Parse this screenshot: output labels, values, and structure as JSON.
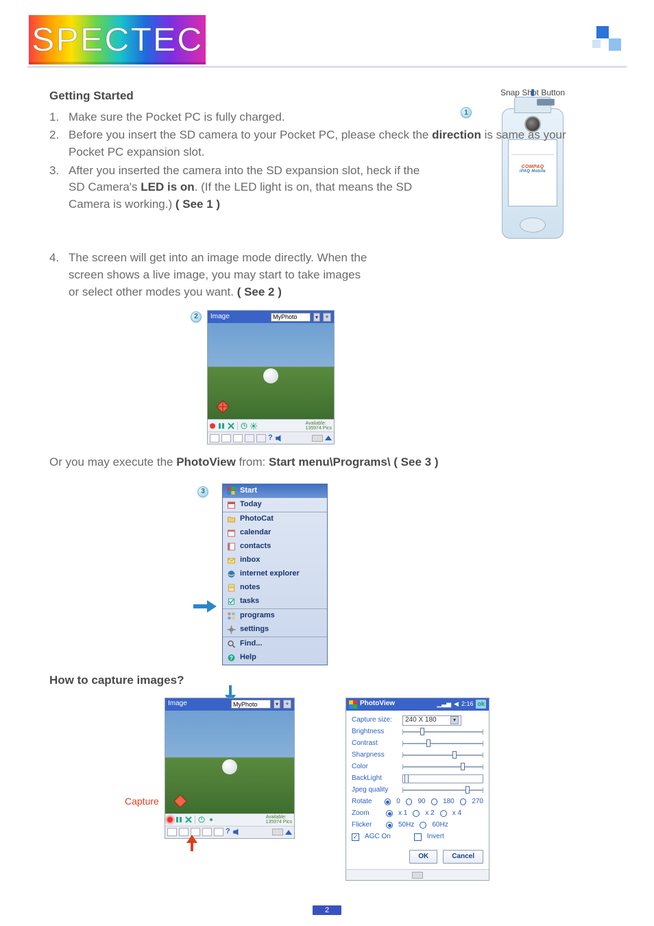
{
  "logo": "SPECTEC",
  "headings": {
    "getting_started": "Getting Started",
    "how_capture": "How to capture images?"
  },
  "steps": {
    "s1": {
      "num": "1.",
      "text": "Make sure the Pocket PC is fully charged."
    },
    "s2": {
      "num": "2.",
      "pre": "Before you insert the SD camera to your Pocket PC, please check the ",
      "bold": "direction",
      "post": " is same as your Pocket PC expansion slot."
    },
    "s3": {
      "num": "3.",
      "pre": "After you inserted the camera into the SD expansion slot, heck if the SD Camera's ",
      "bold": "LED is on",
      "mid": ". (If the LED light is on, that means the SD Camera is working.) ",
      "see": "( See 1 )"
    },
    "s4": {
      "num": "4.",
      "pre": "The screen will get into an image mode directly. When the screen shows a live image, you may start to take images or select other modes you want. ",
      "see": "( See 2 )"
    }
  },
  "or_line": {
    "pre": "Or you may execute the ",
    "b1": "PhotoView",
    "mid": " from: ",
    "b2": "Start menu\\Programs\\ ( See 3 )"
  },
  "callouts": {
    "c1": "1",
    "c2": "2",
    "c3": "3"
  },
  "fig1": {
    "snap_label": "Snap Shot Button",
    "screen_l1": "COMPAQ",
    "screen_l2": "iPAQ Mobile"
  },
  "photoview": {
    "title": "Image",
    "folder": "MyPhoto",
    "plus": "+",
    "available_l1": "Available:",
    "available_l2": "135974 Pics"
  },
  "startmenu": {
    "start": "Start",
    "today": "Today",
    "items": [
      "PhotoCat",
      "calendar",
      "contacts",
      "inbox",
      "internet explorer",
      "notes",
      "tasks"
    ],
    "programs": "programs",
    "settings": "settings",
    "find": "Find...",
    "help": "Help"
  },
  "capture_label": "Capture",
  "settings": {
    "title": "PhotoView",
    "time": "2:16",
    "ok_badge": "ok",
    "capture_size_label": "Capture size:",
    "capture_size_value": "240 X 180",
    "brightness": "Brightness",
    "contrast": "Contrast",
    "sharpness": "Sharpness",
    "color": "Color",
    "backlight": "BackLight",
    "jpeg": "Jpeg quality",
    "rotate": "Rotate",
    "rotate_opts": [
      "0",
      "90",
      "180",
      "270"
    ],
    "zoom": "Zoom",
    "zoom_opts": [
      "x 1",
      "x 2",
      "x 4"
    ],
    "flicker": "Flicker",
    "flicker_opts": [
      "50Hz",
      "60Hz"
    ],
    "agc": "AGC On",
    "invert": "Invert",
    "ok": "OK",
    "cancel": "Cancel",
    "slider_pos": {
      "brightness": 22,
      "contrast": 30,
      "sharpness": 62,
      "color": 72,
      "backlight": 2,
      "jpeg": 78
    }
  },
  "page_number": "2"
}
